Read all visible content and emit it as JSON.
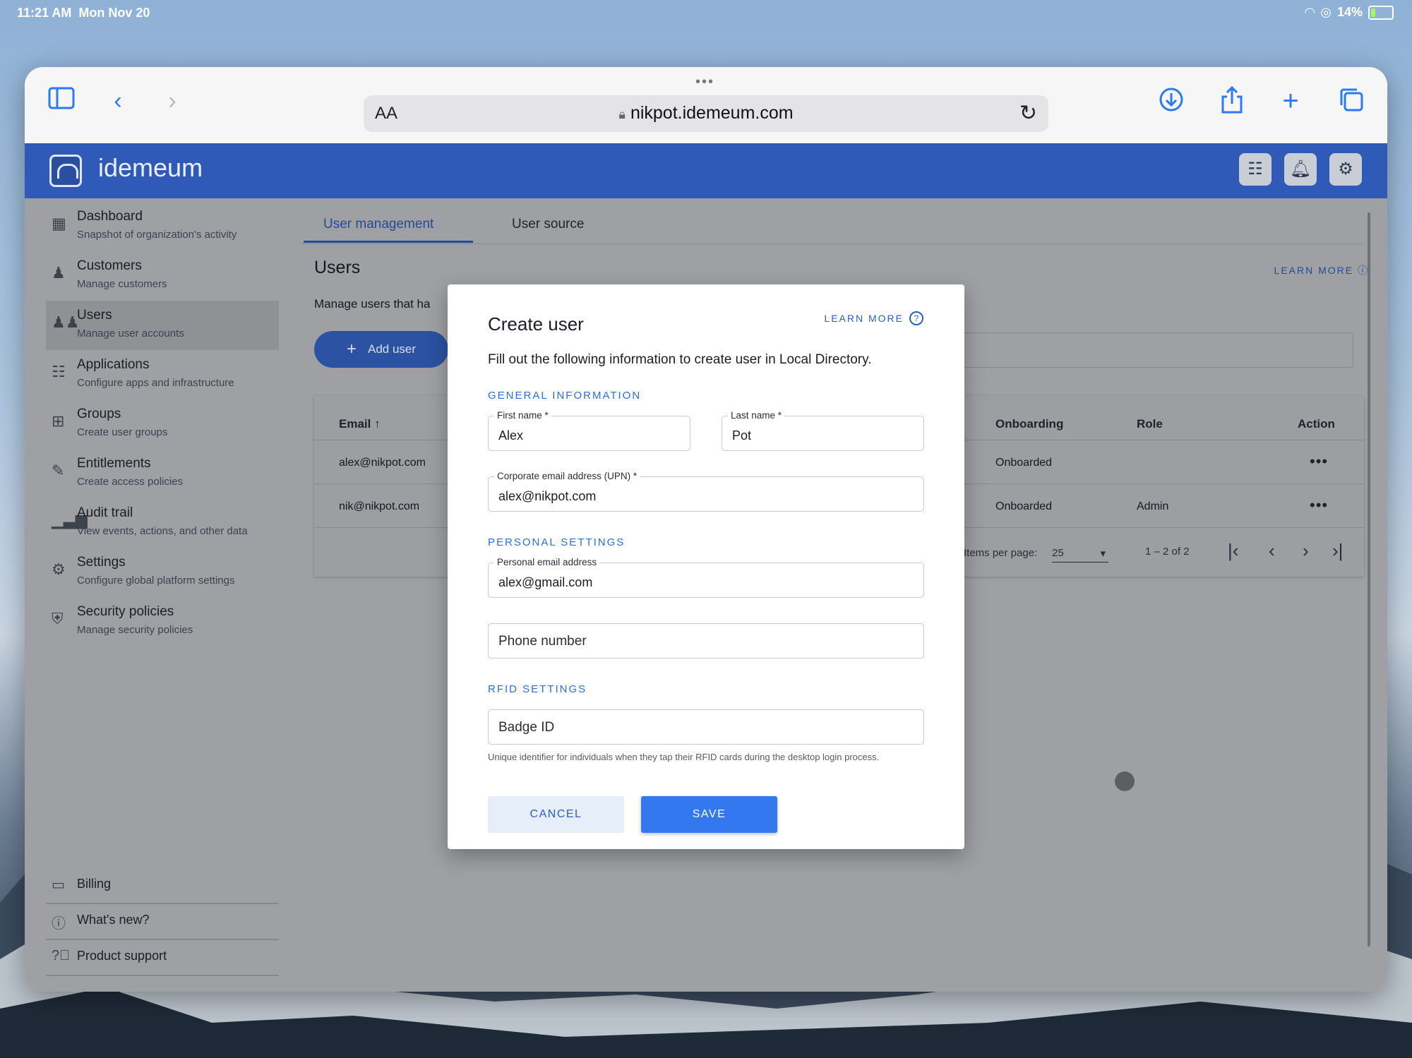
{
  "status_bar": {
    "time": "11:21 AM",
    "date": "Mon Nov 20",
    "battery": "14%"
  },
  "browser": {
    "text_size": "AA",
    "url": "nikpot.idemeum.com"
  },
  "app": {
    "brand": "idemeum"
  },
  "sidebar": {
    "items": [
      {
        "title": "Dashboard",
        "subtitle": "Snapshot of organization's activity",
        "icon": "dashboard-icon"
      },
      {
        "title": "Customers",
        "subtitle": "Manage customers",
        "icon": "customers-icon"
      },
      {
        "title": "Users",
        "subtitle": "Manage user accounts",
        "icon": "users-icon"
      },
      {
        "title": "Applications",
        "subtitle": "Configure apps and infrastructure",
        "icon": "apps-grid-icon"
      },
      {
        "title": "Groups",
        "subtitle": "Create user groups",
        "icon": "groups-icon"
      },
      {
        "title": "Entitlements",
        "subtitle": "Create access policies",
        "icon": "entitlements-icon"
      },
      {
        "title": "Audit trail",
        "subtitle": "View events, actions, and other data",
        "icon": "bar-chart-icon"
      },
      {
        "title": "Settings",
        "subtitle": "Configure global platform settings",
        "icon": "settings-icon"
      },
      {
        "title": "Security policies",
        "subtitle": "Manage security policies",
        "icon": "shield-icon"
      }
    ],
    "footer": [
      {
        "title": "Billing",
        "icon": "billing-icon"
      },
      {
        "title": "What's new?",
        "icon": "info-icon"
      },
      {
        "title": "Product support",
        "icon": "help-icon"
      }
    ]
  },
  "main": {
    "tabs": [
      "User management",
      "User source"
    ],
    "heading": "Users",
    "learn_more": "LEARN MORE",
    "description": "Manage users that ha",
    "add_user": "Add user",
    "table": {
      "columns": [
        "Email",
        "Onboarding",
        "Role",
        "Action"
      ],
      "rows": [
        {
          "email": "alex@nikpot.com",
          "onboarding": "Onboarded",
          "role": ""
        },
        {
          "email": "nik@nikpot.com",
          "onboarding": "Onboarded",
          "role": "Admin"
        }
      ],
      "items_per_page_label": "Items per page:",
      "items_per_page": "25",
      "range": "1 – 2 of 2"
    }
  },
  "modal": {
    "title": "Create user",
    "learn_more": "LEARN MORE",
    "description": "Fill out the following information to create user in Local Directory.",
    "sections": {
      "general": "GENERAL INFORMATION",
      "personal": "PERSONAL SETTINGS",
      "rfid": "RFID SETTINGS"
    },
    "fields": {
      "first_name_label": "First name *",
      "first_name": "Alex",
      "last_name_label": "Last name *",
      "last_name": "Pot",
      "corp_email_label": "Corporate email address (UPN) *",
      "corp_email": "alex@nikpot.com",
      "personal_email_label": "Personal email address",
      "personal_email": "alex@gmail.com",
      "phone_placeholder": "Phone number",
      "badge_placeholder": "Badge ID"
    },
    "badge_hint": "Unique identifier for individuals when they tap their RFID cards during the desktop login process.",
    "cancel": "CANCEL",
    "save": "SAVE"
  }
}
